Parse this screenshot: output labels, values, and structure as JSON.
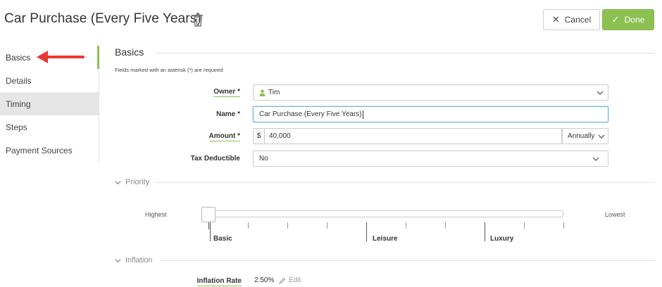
{
  "header": {
    "title": "Car Purchase (Every Five Years)",
    "cancel_label": "Cancel",
    "done_label": "Done"
  },
  "sidebar": {
    "items": [
      {
        "label": "Basics"
      },
      {
        "label": "Details"
      },
      {
        "label": "Timing"
      },
      {
        "label": "Steps"
      },
      {
        "label": "Payment Sources"
      }
    ]
  },
  "basics": {
    "section_title": "Basics",
    "required_note": "Fields marked with an asterisk (*) are required",
    "owner": {
      "label": "Owner *",
      "value": "Tim"
    },
    "name": {
      "label": "Name *",
      "value": "Car Purchase (Every  Five Years)"
    },
    "amount": {
      "label": "Amount *",
      "currency": "$",
      "value": "40,000",
      "frequency": "Annually"
    },
    "tax": {
      "label": "Tax Deductible",
      "value": "No"
    }
  },
  "priority": {
    "heading": "Priority",
    "low_end": "Highest",
    "high_end": "Lowest",
    "levels": [
      "Basic",
      "Leisure",
      "Luxury"
    ],
    "selected": "Highest"
  },
  "inflation": {
    "heading": "Inflation",
    "label": "Inflation Rate",
    "value": "2.50%",
    "edit_label": "Edit"
  },
  "colors": {
    "accent": "#8cc152",
    "arrow": "#e53935",
    "focus": "#66afe9"
  }
}
